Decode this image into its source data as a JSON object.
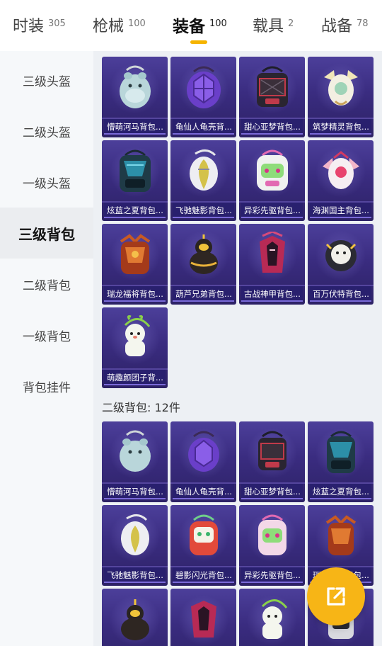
{
  "tabs": [
    {
      "label": "时装",
      "count": "305"
    },
    {
      "label": "枪械",
      "count": "100"
    },
    {
      "label": "装备",
      "count": "100"
    },
    {
      "label": "载具",
      "count": "2"
    },
    {
      "label": "战备",
      "count": "78"
    }
  ],
  "active_tab": "装备",
  "sidebar": {
    "items": [
      {
        "label": "三级头盔"
      },
      {
        "label": "二级头盔"
      },
      {
        "label": "一级头盔"
      },
      {
        "label": "三级背包"
      },
      {
        "label": "二级背包"
      },
      {
        "label": "一级背包"
      },
      {
        "label": "背包挂件"
      }
    ],
    "active": "三级背包"
  },
  "section1": {
    "items": [
      {
        "name": "懵萌河马背包...",
        "icon": "hippo-backpack-icon"
      },
      {
        "name": "龟仙人龟壳背...",
        "icon": "turtle-shell-backpack-icon"
      },
      {
        "name": "甜心亚梦背包...",
        "icon": "sweetheart-backpack-icon"
      },
      {
        "name": "筑梦精灵背包...",
        "icon": "dream-spirit-backpack-icon"
      },
      {
        "name": "炫蓝之夏背包...",
        "icon": "blue-summer-backpack-icon"
      },
      {
        "name": "飞驰魅影背包...",
        "icon": "phantom-backpack-icon"
      },
      {
        "name": "异彩先驱背包...",
        "icon": "pioneer-backpack-icon"
      },
      {
        "name": "海渊国主背包...",
        "icon": "abyss-lord-backpack-icon"
      },
      {
        "name": "瑞龙福将背包...",
        "icon": "dragon-general-backpack-icon"
      },
      {
        "name": "葫芦兄弟背包...",
        "icon": "gourd-brothers-backpack-icon"
      },
      {
        "name": "古战神甲背包...",
        "icon": "war-god-backpack-icon"
      },
      {
        "name": "百万伏特背包...",
        "icon": "million-volt-backpack-icon"
      },
      {
        "name": "萌趣颜团子背...",
        "icon": "dumpling-backpack-icon"
      }
    ]
  },
  "section2": {
    "title": "二级背包: 12件",
    "items": [
      {
        "name": "懵萌河马背包...",
        "icon": "hippo-backpack-icon"
      },
      {
        "name": "龟仙人龟壳背...",
        "icon": "turtle-shell-backpack-icon"
      },
      {
        "name": "甜心亚梦背包...",
        "icon": "sweetheart-backpack-icon"
      },
      {
        "name": "炫蓝之夏背包...",
        "icon": "blue-summer-backpack-icon"
      },
      {
        "name": "飞驰魅影背包...",
        "icon": "phantom-backpack-icon"
      },
      {
        "name": "碧影闪光背包...",
        "icon": "jade-flash-backpack-icon"
      },
      {
        "name": "异彩先驱背包...",
        "icon": "pioneer-backpack-icon"
      },
      {
        "name": "瑞龙福将背包...",
        "icon": "dragon-general-backpack-icon"
      },
      {
        "name": "",
        "icon": "gourd-brothers-backpack-icon"
      },
      {
        "name": "",
        "icon": "war-god-backpack-icon"
      },
      {
        "name": "",
        "icon": "dumpling-backpack-icon"
      },
      {
        "name": "",
        "icon": "million-volt-backpack-icon"
      }
    ]
  },
  "fab": {
    "icon": "external-link-icon"
  },
  "colors": {
    "accent": "#f7b516",
    "card_top": "#4c3f9a",
    "card_bottom": "#2d2266"
  }
}
